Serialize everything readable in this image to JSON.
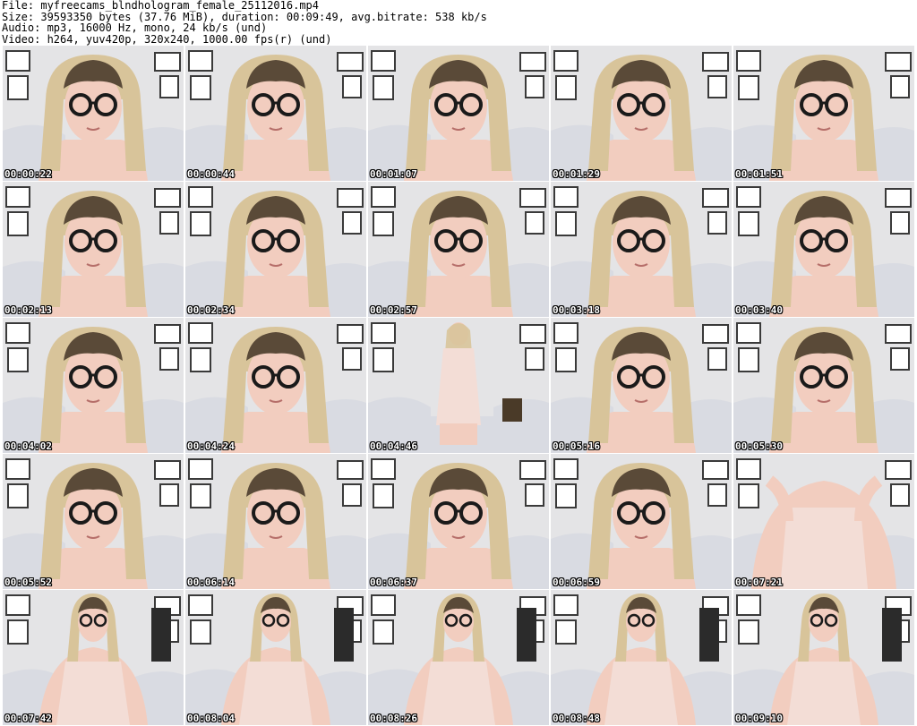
{
  "header": {
    "file": "File: myfreecams_blndhologram_female_25112016.mp4",
    "size": "Size: 39593350 bytes (37.76 MiB), duration: 00:09:49, avg.bitrate: 538 kb/s",
    "audio": "Audio: mp3, 16000 Hz, mono, 24 kb/s (und)",
    "video": "Video: h264, yuv420p, 320x240, 1000.00 fps(r) (und)"
  },
  "thumbnails": [
    {
      "time": "00:00:22",
      "shot": "close"
    },
    {
      "time": "00:00:44",
      "shot": "close"
    },
    {
      "time": "00:01:07",
      "shot": "close"
    },
    {
      "time": "00:01:29",
      "shot": "close"
    },
    {
      "time": "00:01:51",
      "shot": "close"
    },
    {
      "time": "00:02:13",
      "shot": "close"
    },
    {
      "time": "00:02:34",
      "shot": "close"
    },
    {
      "time": "00:02:57",
      "shot": "close"
    },
    {
      "time": "00:03:18",
      "shot": "close"
    },
    {
      "time": "00:03:40",
      "shot": "close"
    },
    {
      "time": "00:04:02",
      "shot": "close"
    },
    {
      "time": "00:04:24",
      "shot": "close"
    },
    {
      "time": "00:04:46",
      "shot": "wide"
    },
    {
      "time": "00:05:16",
      "shot": "close"
    },
    {
      "time": "00:05:30",
      "shot": "close"
    },
    {
      "time": "00:05:52",
      "shot": "close"
    },
    {
      "time": "00:06:14",
      "shot": "close"
    },
    {
      "time": "00:06:37",
      "shot": "close"
    },
    {
      "time": "00:06:59",
      "shot": "close"
    },
    {
      "time": "00:07:21",
      "shot": "torso"
    },
    {
      "time": "00:07:42",
      "shot": "mid"
    },
    {
      "time": "00:08:04",
      "shot": "mid"
    },
    {
      "time": "00:08:26",
      "shot": "mid"
    },
    {
      "time": "00:08:48",
      "shot": "mid"
    },
    {
      "time": "00:09:10",
      "shot": "mid"
    }
  ],
  "colors": {
    "wall": "#e4e4e6",
    "hair": "#d8c49a",
    "hair_root": "#5a4a38",
    "skin": "#f2cdbf",
    "glasses": "#1a1a1a",
    "bedding": "#d9dbe2",
    "slip": "#f3ddd6",
    "frame": "#3a3a3a"
  }
}
